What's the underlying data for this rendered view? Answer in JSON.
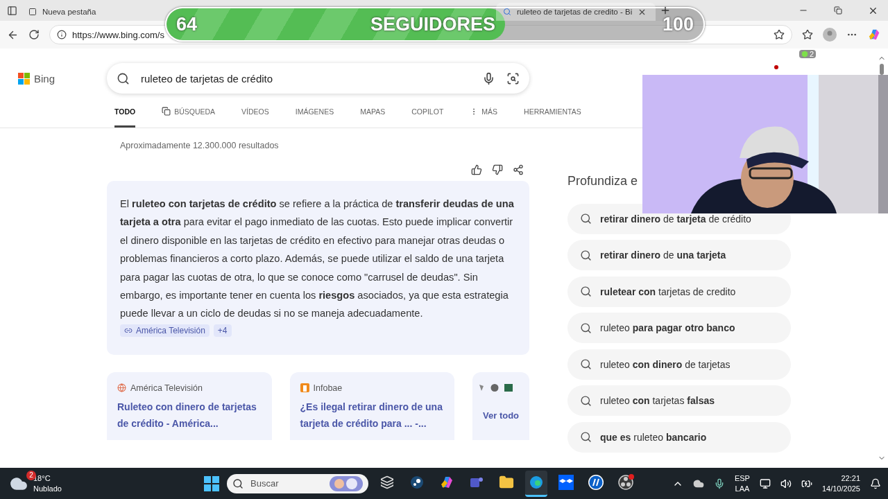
{
  "browser_tabs": [
    {
      "title": "Nueva pestaña",
      "selected": false
    },
    {
      "title": "ruleteo de tarjetas de credito - Bi",
      "selected": true
    }
  ],
  "address": "https://www.bing.com/s",
  "followers": {
    "current": "64",
    "label": "SEGUIDORES",
    "goal": "100",
    "level": 0.63
  },
  "rewards_badge": "2",
  "brand": "Bing",
  "query": "ruleteo de tarjetas de crédito",
  "nav": [
    {
      "label": "TODO",
      "selected": true,
      "kind": "text"
    },
    {
      "label": "BÚSQUEDA",
      "selected": false,
      "kind": "copilot"
    },
    {
      "label": "VÍDEOS",
      "selected": false,
      "kind": "text"
    },
    {
      "label": "IMÁGENES",
      "selected": false,
      "kind": "text"
    },
    {
      "label": "MAPAS",
      "selected": false,
      "kind": "text"
    },
    {
      "label": "COPILOT",
      "selected": false,
      "kind": "text"
    },
    {
      "label": "MÁS",
      "selected": false,
      "kind": "more"
    },
    {
      "label": "HERRAMIENTAS",
      "selected": false,
      "kind": "text"
    }
  ],
  "result_count": "Aproximadamente 12.300.000 resultados",
  "answer": {
    "text": "El **ruleteo con tarjetas de crédito** se refiere a la práctica de **transferir deudas de una tarjeta a otra** para evitar el pago inmediato de las cuotas. Esto puede implicar convertir el dinero disponible en las tarjetas de crédito en efectivo para manejar otras deudas o problemas financieros a corto plazo. Además, se puede utilizar el saldo de una tarjeta para pagar las cuotas de otra, lo que se conoce como \"carrusel de deudas\". Sin embargo, es importante tener en cuenta los **riesgos** asociados, ya que esta estrategia puede llevar a un ciclo de deudas si no se maneja adecuadamente.",
    "source": "América Televisión",
    "more_sources": "+4"
  },
  "source_cards": [
    {
      "site": "América Televisión",
      "kind": "globe",
      "title": "Ruleteo con dinero de tarjetas de crédito - América..."
    },
    {
      "site": "Infobae",
      "kind": "infobae",
      "title": "¿Es ilegal retirar dinero de una tarjeta de crédito para ... -..."
    }
  ],
  "see_all": "Ver todo",
  "related_heading": "Profundiza e",
  "related": [
    "**retirar dinero** de **tarjeta** de crédito",
    "**retirar dinero** de **una tarjeta**",
    "**ruletear con** tarjetas de credito",
    "ruleteo **para pagar otro banco**",
    "ruleteo **con dinero** de tarjetas",
    "ruleteo **con** tarjetas **falsas**",
    "**que es** ruleteo **bancario**"
  ],
  "webcam": {
    "kind": "picture"
  },
  "taskbar": {
    "weather_badge": "2",
    "temperature": "18°C",
    "condition": "Nublado",
    "search_placeholder": "Buscar",
    "apps": [
      {
        "kind": "taskview",
        "active": false
      },
      {
        "kind": "steam",
        "active": false
      },
      {
        "kind": "copilot",
        "active": false
      },
      {
        "kind": "teams",
        "active": false
      },
      {
        "kind": "folder",
        "active": false
      },
      {
        "kind": "edge",
        "active": true
      },
      {
        "kind": "dropbox",
        "active": false
      },
      {
        "kind": "hp",
        "active": false
      },
      {
        "kind": "obs",
        "active": false
      }
    ],
    "language": "ESP",
    "layout": "LAA",
    "time": "22:21",
    "date": "14/10/2025"
  }
}
